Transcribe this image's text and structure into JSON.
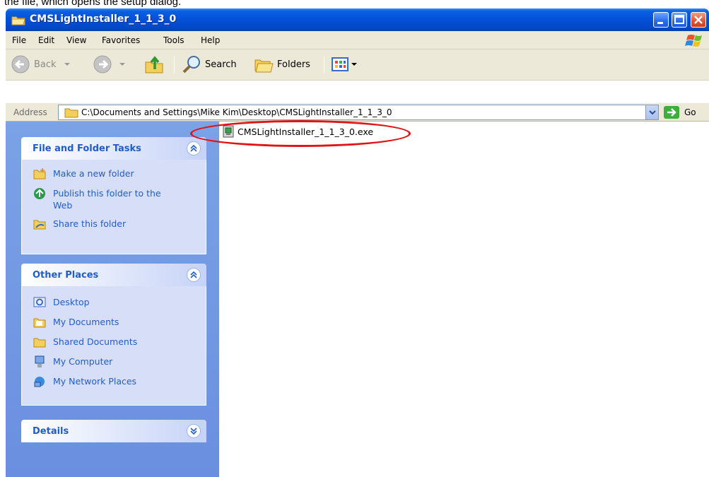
{
  "caption": "the file, which opens the setup dialog.",
  "window": {
    "title": "CMSLightInstaller_1_1_3_0"
  },
  "menu": [
    "File",
    "Edit",
    "View",
    "Favorites",
    "Tools",
    "Help"
  ],
  "toolbar": {
    "back_label": "Back",
    "search_label": "Search",
    "folders_label": "Folders"
  },
  "address": {
    "label": "Address",
    "path": "C:\\Documents and Settings\\Mike Kim\\Desktop\\CMSLightInstaller_1_1_3_0",
    "go_label": "Go"
  },
  "tasks_panel": {
    "title": "File and Folder Tasks",
    "items": [
      "Make a new folder",
      "Publish this folder to the Web",
      "Share this folder"
    ]
  },
  "places_panel": {
    "title": "Other Places",
    "items": [
      "Desktop",
      "My Documents",
      "Shared Documents",
      "My Computer",
      "My Network Places"
    ]
  },
  "details_panel": {
    "title": "Details"
  },
  "files": [
    {
      "name": "CMSLightInstaller_1_1_3_0.exe",
      "icon": "installer-exe-icon"
    }
  ],
  "colors": {
    "annotation_circle": "#e01414",
    "task_link": "#215dc6",
    "titlebar": "#0450d8"
  }
}
